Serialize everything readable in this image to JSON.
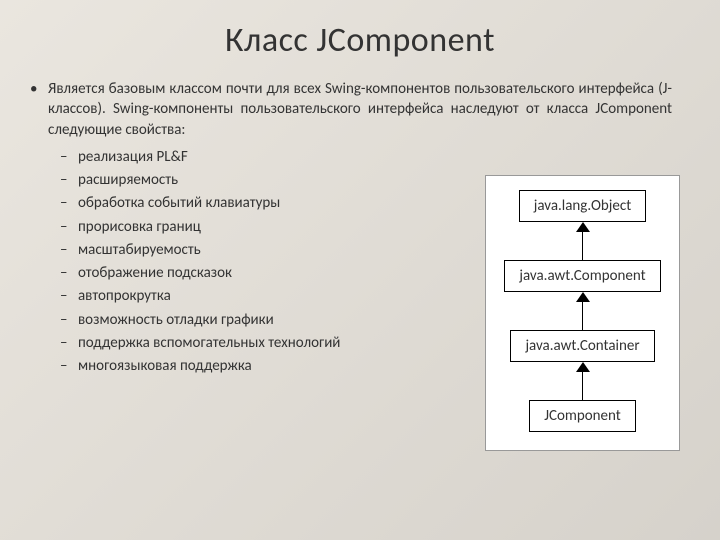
{
  "title": "Класс JComponent",
  "intro": "Является базовым классом почти для всех Swing-компонентов пользовательского интерфейса (J-классов). Swing-компоненты пользовательского интерфейса наследуют от класса JComponent следующие свойства:",
  "features": [
    "реализация PL&F",
    "расширяемость",
    "обработка событий клавиатуры",
    "прорисовка границ",
    "масштабируемость",
    "отображение подсказок",
    "автопрокрутка",
    "возможность отладки графики",
    "поддержка вспомогательных технологий",
    "многоязыковая поддержка"
  ],
  "hierarchy": [
    "java.lang.Object",
    "java.awt.Component",
    "java.awt.Container",
    "JComponent"
  ]
}
